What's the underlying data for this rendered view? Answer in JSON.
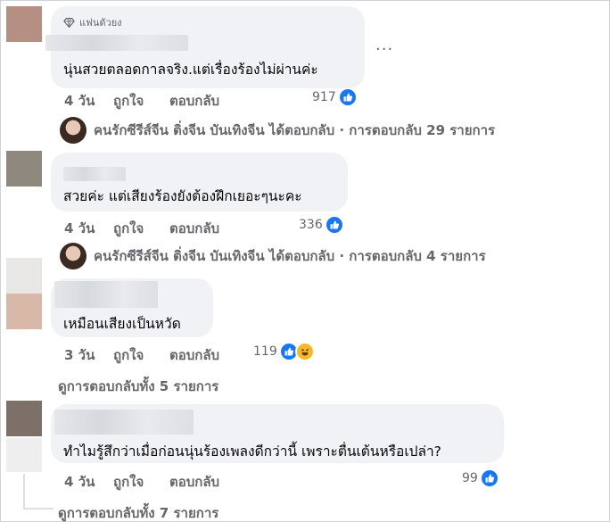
{
  "comments": [
    {
      "badge": "แฟนตัวยง",
      "text": "นุ่นสวยตลอดกาลจริง.แต่เรื่องร้องไม่ผ่านค่ะ",
      "time": "4 วัน",
      "like_label": "ถูกใจ",
      "reply_label": "ตอบกลับ",
      "reaction_count": "917",
      "reply_summary": "คนรักซีรีส์จีน ติ่งจีน บันเทิงจีน ได้ตอบกลับ · การตอบกลับ 29 รายการ",
      "avatar_color": "#b58f82"
    },
    {
      "text": "สวยค่ะ แต่เสียงร้องยังต้องฝึกเยอะๆนะคะ",
      "time": "4 วัน",
      "like_label": "ถูกใจ",
      "reply_label": "ตอบกลับ",
      "reaction_count": "336",
      "reply_summary": "คนรักซีรีส์จีน ติ่งจีน บันเทิงจีน ได้ตอบกลับ · การตอบกลับ 4 รายการ",
      "avatar_color": "#8f887f"
    },
    {
      "text": "เหมือนเสียงเป็นหวัด",
      "time": "3 วัน",
      "like_label": "ถูกใจ",
      "reply_label": "ตอบกลับ",
      "reaction_count": "119",
      "view_replies": "ดูการตอบกลับทั้ง 5 รายการ",
      "avatar_color": "#d8b8a8"
    },
    {
      "text": "ทำไมรู้สึกว่าเมื่อก่อนนุ่นร้องเพลงดีกว่านี้ เพราะตื่นเต้นหรือเปล่า?",
      "time": "4 วัน",
      "like_label": "ถูกใจ",
      "reply_label": "ตอบกลับ",
      "reaction_count": "99",
      "view_replies": "ดูการตอบกลับทั้ง 7 รายการ",
      "avatar_color": "#7c7068"
    }
  ],
  "more_icon": "ellipsis-icon",
  "colors": {
    "bubble": "#f0f2f5",
    "meta": "#65676b",
    "like_blue": "#1877f2",
    "haha_yellow": "#f7b928"
  }
}
